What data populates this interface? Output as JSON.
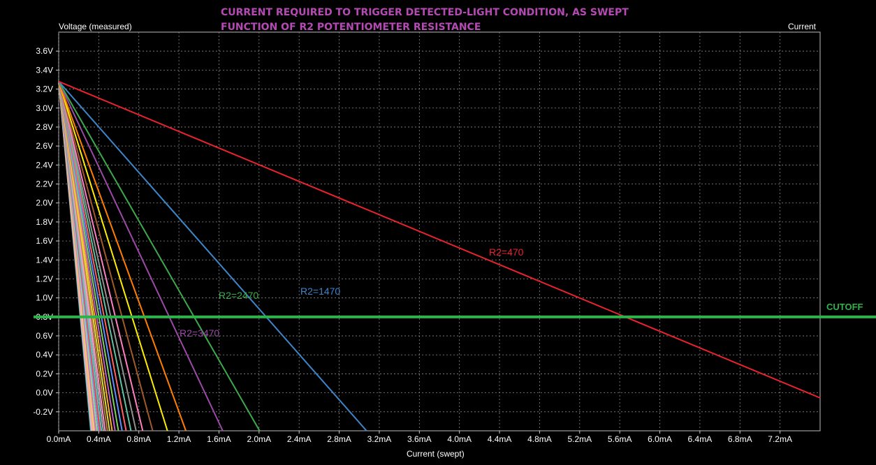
{
  "title_lines": [
    "CURRENT REQUIRED TO TRIGGER DETECTED-LIGHT CONDITION, AS SWEPT",
    "FUNCTION OF R2 POTENTIOMETER RESISTANCE"
  ],
  "left_header": "Voltage (measured)",
  "right_header": "Current",
  "chart_data": {
    "type": "line",
    "title": "CURRENT REQUIRED TO TRIGGER DETECTED-LIGHT CONDITION, AS SWEPT FUNCTION OF R2 POTENTIOMETER RESISTANCE",
    "xlabel": "Current (swept)",
    "ylabel": "Voltage (measured)",
    "xlim": [
      0,
      7.6
    ],
    "ylim": [
      -0.4,
      3.8
    ],
    "x_ticks": [
      "0.0mA",
      "0.4mA",
      "0.8mA",
      "1.2mA",
      "1.6mA",
      "2.0mA",
      "2.4mA",
      "2.8mA",
      "3.2mA",
      "3.6mA",
      "4.0mA",
      "4.4mA",
      "4.8mA",
      "5.2mA",
      "5.6mA",
      "6.0mA",
      "6.4mA",
      "6.8mA",
      "7.2mA"
    ],
    "y_ticks": [
      "-0.2V",
      "0.0V",
      "0.2V",
      "0.4V",
      "0.6V",
      "0.8V",
      "1.0V",
      "1.2V",
      "1.4V",
      "1.6V",
      "1.8V",
      "2.0V",
      "2.2V",
      "2.4V",
      "2.6V",
      "2.8V",
      "3.0V",
      "3.2V",
      "3.4V",
      "3.6V"
    ],
    "grid": true,
    "start_voltage": 3.28,
    "series": [
      {
        "name": "R2=470",
        "slope_ma_per_v": 2.28,
        "color": "#e8232e"
      },
      {
        "name": "R2=1470",
        "slope_ma_per_v": 0.835,
        "color": "#3d86c9"
      },
      {
        "name": "R2=2470",
        "slope_ma_per_v": 0.545,
        "color": "#3caa4b"
      },
      {
        "name": "R2=3470",
        "slope_ma_per_v": 0.445,
        "color": "#9d49a8"
      },
      {
        "name": "",
        "slope_ma_per_v": 0.345,
        "color": "#ff7f00"
      },
      {
        "name": "",
        "slope_ma_per_v": 0.295,
        "color": "#ffee00"
      },
      {
        "name": "",
        "slope_ma_per_v": 0.255,
        "color": "#a05a2c"
      },
      {
        "name": "",
        "slope_ma_per_v": 0.228,
        "color": "#ff80c0"
      },
      {
        "name": "",
        "slope_ma_per_v": 0.21,
        "color": "#909090"
      },
      {
        "name": "",
        "slope_ma_per_v": 0.196,
        "color": "#60c0a0"
      },
      {
        "name": "",
        "slope_ma_per_v": 0.183,
        "color": "#ff6060"
      },
      {
        "name": "",
        "slope_ma_per_v": 0.172,
        "color": "#6090ff"
      },
      {
        "name": "",
        "slope_ma_per_v": 0.162,
        "color": "#80d060"
      },
      {
        "name": "",
        "slope_ma_per_v": 0.153,
        "color": "#c060c0"
      },
      {
        "name": "",
        "slope_ma_per_v": 0.145,
        "color": "#ffb030"
      },
      {
        "name": "",
        "slope_ma_per_v": 0.138,
        "color": "#e0e040"
      },
      {
        "name": "",
        "slope_ma_per_v": 0.132,
        "color": "#c08040"
      },
      {
        "name": "",
        "slope_ma_per_v": 0.126,
        "color": "#ff9ad0"
      },
      {
        "name": "",
        "slope_ma_per_v": 0.121,
        "color": "#b0b0b0"
      },
      {
        "name": "",
        "slope_ma_per_v": 0.116,
        "color": "#50c8c8"
      },
      {
        "name": "",
        "slope_ma_per_v": 0.112,
        "color": "#ff4040"
      },
      {
        "name": "",
        "slope_ma_per_v": 0.108,
        "color": "#70a0ff"
      },
      {
        "name": "",
        "slope_ma_per_v": 0.104,
        "color": "#a0e080"
      },
      {
        "name": "",
        "slope_ma_per_v": 0.1,
        "color": "#d070d0"
      },
      {
        "name": "",
        "slope_ma_per_v": 0.097,
        "color": "#ffd060"
      },
      {
        "name": "",
        "slope_ma_per_v": 0.094,
        "color": "#e0c080"
      },
      {
        "name": "",
        "slope_ma_per_v": 0.091,
        "color": "#ffa0c0"
      },
      {
        "name": "",
        "slope_ma_per_v": 0.089,
        "color": "#c8c8c8"
      },
      {
        "name": "",
        "slope_ma_per_v": 0.087,
        "color": "#40b0b0"
      }
    ],
    "cutoff": {
      "label": "CUTOFF",
      "value": 0.8,
      "color": "#2eb24a"
    }
  }
}
